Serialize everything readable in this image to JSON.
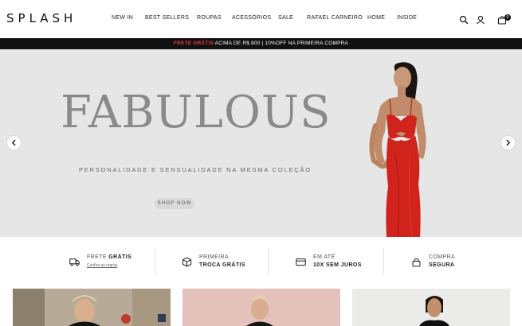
{
  "brand": {
    "logo": "SPLASH"
  },
  "nav": {
    "items": [
      {
        "label": "NEW IN"
      },
      {
        "label": "BEST SELLERS"
      },
      {
        "label": "ROUPAS"
      },
      {
        "label": "ACESSÓRIOS"
      },
      {
        "label": "SALE"
      },
      {
        "label": "RAFAEL CARNEIRO"
      },
      {
        "label": "HOME"
      },
      {
        "label": "INSIDE"
      }
    ]
  },
  "header_icons": [
    "search-icon",
    "user-icon",
    "bag-icon"
  ],
  "cart": {
    "count": "0"
  },
  "announcement": {
    "highlight": "FRETE GRÁTIS",
    "text": " ACIMA DE R$ 800 | 10%OFF NA PRIMEIRA COMPRA"
  },
  "hero": {
    "title": "FABULOUS",
    "subtitle": "PERSONALIDADE E SENSUALIDADE NA MESMA COLEÇÃO",
    "cta": "SHOP NOW"
  },
  "benefits": [
    {
      "icon": "truck-icon",
      "line1_prefix": "FRETE ",
      "line1_bold": "GRÁTIS",
      "link": "Confira as regras"
    },
    {
      "icon": "box-icon",
      "line1": "PRIMEIRA",
      "line2": "TROCA GRÁTIS"
    },
    {
      "icon": "card-icon",
      "line1": "EM ATÉ",
      "line2": "10X SEM JUROS"
    },
    {
      "icon": "lock-icon",
      "line1": "COMPRA",
      "line2": "SEGURA"
    }
  ],
  "colors": {
    "announcement_bg": "#111111",
    "announcement_highlight": "#e53935",
    "hero_bg": "#e6e6e6",
    "dress": "#d0231c"
  }
}
